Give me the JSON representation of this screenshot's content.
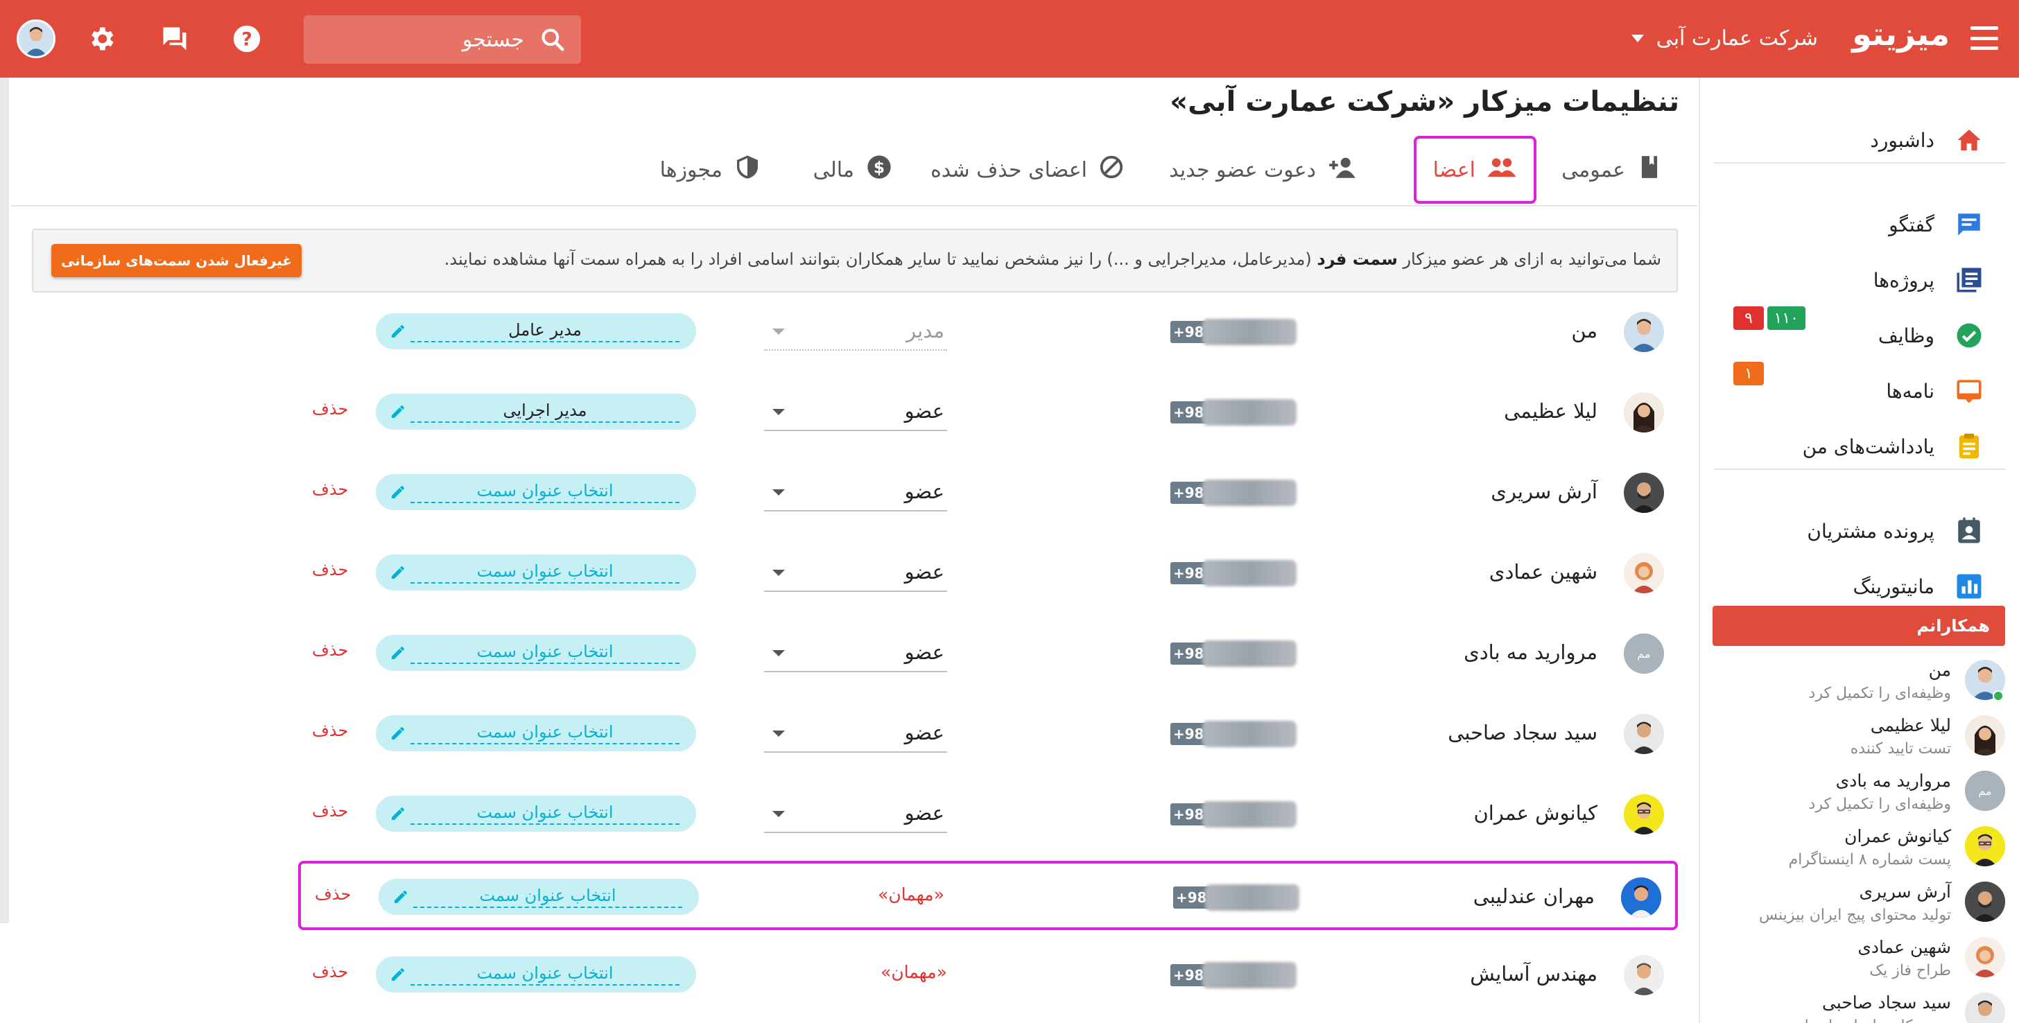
{
  "header": {
    "brand": "میزیتو",
    "company": "شرکت عمارت آبی",
    "search_placeholder": "جستجو",
    "colors": {
      "primary": "#e04b3c"
    }
  },
  "sidebar": {
    "nav": [
      {
        "label": "داشبورد",
        "icon": "home-icon"
      },
      {
        "label": "گفتگو",
        "icon": "chat-icon"
      },
      {
        "label": "پروژه‌ها",
        "icon": "projects-icon"
      },
      {
        "label": "وظایف",
        "icon": "check-circle-icon",
        "badges": [
          "۱۱۰",
          "۹"
        ]
      },
      {
        "label": "نامه‌ها",
        "icon": "inbox-icon",
        "badges": [
          "۱"
        ]
      },
      {
        "label": "یادداشت‌های من",
        "icon": "notes-icon"
      },
      {
        "label": "پرونده مشتریان",
        "icon": "contact-icon"
      },
      {
        "label": "مانیتورینگ",
        "icon": "chart-icon"
      }
    ],
    "colleagues_title": "همکارانم",
    "colleagues": [
      {
        "name": "من",
        "status": "وظیفه‌ای را تکمیل کرد"
      },
      {
        "name": "لیلا عظیمی",
        "status": "تست تایید کننده"
      },
      {
        "name": "مروارید مه بادی",
        "status": "وظیفه‌ای را تکمیل کرد"
      },
      {
        "name": "کیانوش عمران",
        "status": "پست شماره ۸ اینستاگرام"
      },
      {
        "name": "آرش سریری",
        "status": "تولید محتوای پیج ایران بیزینس"
      },
      {
        "name": "شهین عمادی",
        "status": "طراح فاز یک"
      },
      {
        "name": "سید سجاد صاحبی",
        "status": "هزینه کاری انجام داده است"
      }
    ]
  },
  "main": {
    "title": "تنظیمات میزکار «شرکت عمارت آبی»",
    "tabs": [
      {
        "label": "عمومی"
      },
      {
        "label": "اعضا"
      },
      {
        "label": "دعوت عضو جدید"
      },
      {
        "label": "اعضای حذف شده"
      },
      {
        "label": "مالی"
      },
      {
        "label": "مجوزها"
      }
    ],
    "info": {
      "text_before": "شما می‌توانید به ازای هر عضو میزکار ",
      "text_bold": "سمت فرد",
      "text_after": " (مدیرعامل، مدیراجرایی و ...) را نیز مشخص نمایید تا سایر همکاران بتوانند اسامی افراد را به همراه سمت آنها مشاهده نمایند.",
      "button": "غیرفعال شدن سمت‌های سازمانی"
    },
    "members": [
      {
        "name": "من",
        "phone_prefix": "+98",
        "role": "مدیر",
        "position": "مدیر عامل",
        "delete": ""
      },
      {
        "name": "لیلا عظیمی",
        "phone_prefix": "+98",
        "role": "عضو",
        "position": "مدیر اجرایی",
        "delete": "حذف"
      },
      {
        "name": "آرش سریری",
        "phone_prefix": "+98",
        "role": "عضو",
        "position": "انتخاب عنوان سمت",
        "delete": "حذف"
      },
      {
        "name": "شهین عمادی",
        "phone_prefix": "+98",
        "role": "عضو",
        "position": "انتخاب عنوان سمت",
        "delete": "حذف"
      },
      {
        "name": "مروارید مه بادی",
        "phone_prefix": "+98",
        "role": "عضو",
        "position": "انتخاب عنوان سمت",
        "delete": "حذف"
      },
      {
        "name": "سید سجاد صاحبی",
        "phone_prefix": "+98",
        "role": "عضو",
        "position": "انتخاب عنوان سمت",
        "delete": "حذف"
      },
      {
        "name": "کیانوش عمران",
        "phone_prefix": "+98",
        "role": "عضو",
        "position": "انتخاب عنوان سمت",
        "delete": "حذف"
      },
      {
        "name": "مهران عندلیبی",
        "phone_prefix": "+98",
        "role": "«مهمان»",
        "position": "انتخاب عنوان سمت",
        "delete": "حذف"
      },
      {
        "name": "مهندس آسایش",
        "phone_prefix": "+98",
        "role": "«مهمان»",
        "position": "انتخاب عنوان سمت",
        "delete": "حذف"
      }
    ]
  }
}
